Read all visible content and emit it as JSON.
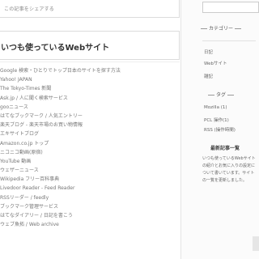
{
  "top_banner": {
    "text": "この記事をシェアする"
  },
  "section": {
    "title": "いつも使っているWebサイト"
  },
  "links": [
    "Google 検索・ひとりでトップ日本のサイトを探す方法",
    "Yahoo! JAPAN",
    "The Tokyo-Times 新聞",
    "Ask.jp / 人に聞く検索サービス",
    "gooニュース",
    "はてなブックマーク / 人気エントリー",
    "楽天ブログ - 楽天市場のお買い物情報",
    "エキサイトブログ",
    "Amazon.co.jp トップ",
    "ニコニコ動画(原宿)",
    "YouTube 動画",
    "ウェザーニュース",
    "Wikipedia フリー百科事典",
    "Livedoor Reader - Feed Reader",
    "RSSリーダー / feedly",
    "ブックマーク管理サービス",
    "はてなダイアリー / 日記を書こう",
    "ウェブ魚拓 / Web archive"
  ],
  "sidebar": {
    "search_placeholder": "",
    "heading1": "カテゴリー",
    "items1": [
      "日記",
      "Webサイト",
      "雑記"
    ],
    "heading2": "タグ",
    "items2": [
      "Mozilla (1)",
      "PCL 操作(1)",
      "RSS (操作時間)"
    ],
    "recent_heading": "最新記事一覧",
    "recent_text": "いつも使っているWebサイトの紹介とお気に入りの設定について書いています。サイトの一覧を更新しました。"
  }
}
